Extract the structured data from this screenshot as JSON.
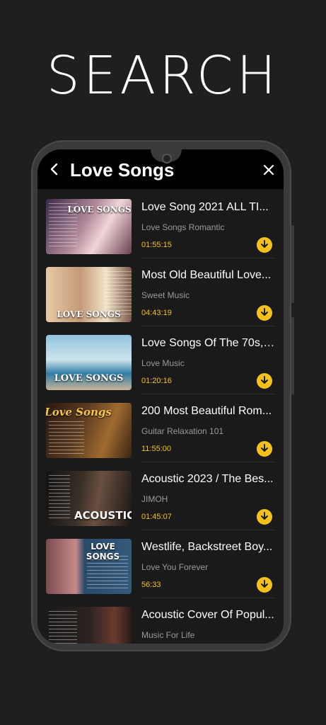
{
  "headline": "SEARCH",
  "appbar": {
    "title": "Love Songs"
  },
  "colors": {
    "accent": "#f6c21a",
    "background": "#1f1f21"
  },
  "icons": {
    "back": "back-arrow-icon",
    "close": "close-icon",
    "download": "download-icon"
  },
  "songs": [
    {
      "title": "Love Song 2021 ALL TI...",
      "channel": "Love Songs Romantic",
      "duration": "01:55:15",
      "thumb_text": "LOVE SONGS"
    },
    {
      "title": "Most Old Beautiful Love...",
      "channel": "Sweet Music",
      "duration": "04:43:19",
      "thumb_text": "LOVE SONGS"
    },
    {
      "title": "Love Songs Of The 70s, ...",
      "channel": "Love Music",
      "duration": "01:20:16",
      "thumb_text": "LOVE SONGS"
    },
    {
      "title": "200 Most Beautiful Rom...",
      "channel": "Guitar Relaxation 101",
      "duration": "11:55:00",
      "thumb_text": "Love Songs"
    },
    {
      "title": "Acoustic 2023 / The Bes...",
      "channel": "JIMOH",
      "duration": "01:45:07",
      "thumb_text": "ACOUSTIC"
    },
    {
      "title": "Westlife, Backstreet Boy...",
      "channel": "Love You Forever",
      "duration": "56:33",
      "thumb_text": "LOVE SONGS"
    },
    {
      "title": "Acoustic Cover Of Popul...",
      "channel": "Music For Life",
      "duration": "",
      "thumb_text": ""
    }
  ]
}
